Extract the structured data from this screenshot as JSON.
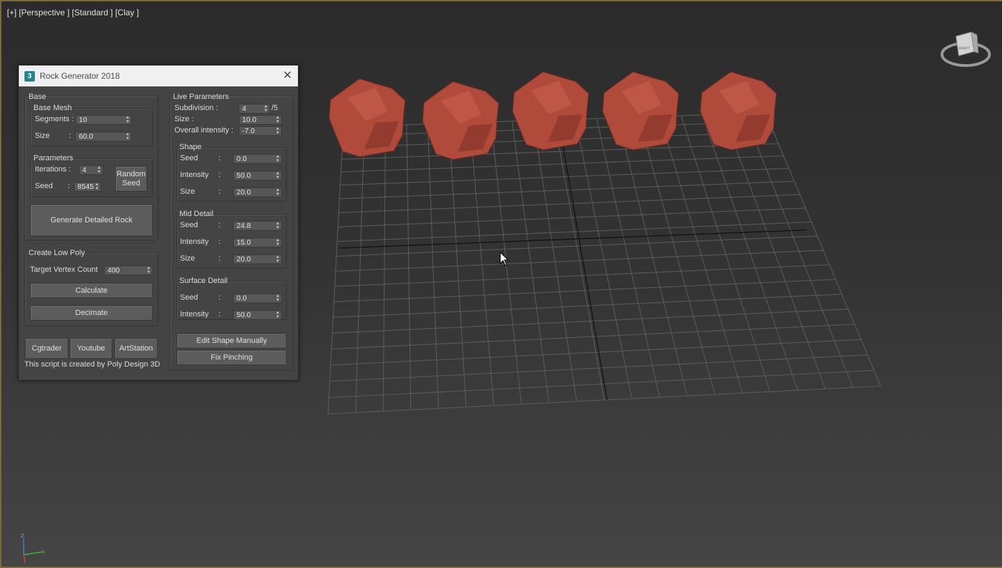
{
  "viewport": {
    "label": "[+] [Perspective ] [Standard ] [Clay ]"
  },
  "viewcube": {
    "face": "RIGHT"
  },
  "axis": {
    "z": "z",
    "x": "x"
  },
  "colors": {
    "rock": "#b04a3a",
    "accent": "#27848f",
    "frame": "#7d6a3c"
  },
  "dialog": {
    "title": "Rock Generator 2018",
    "icon": "3",
    "base": {
      "title": "Base",
      "base_mesh": {
        "title": "Base Mesh",
        "segments_label": "Segments :",
        "segments_value": "10",
        "size_label": "Size",
        "size_colon": ":",
        "size_value": "60.0"
      },
      "parameters": {
        "title": "Parameters",
        "iterations_label": "Iterations :",
        "iterations_value": "4",
        "seed_label": "Seed",
        "seed_colon": ":",
        "seed_value": "8545",
        "random_seed": "Random Seed"
      },
      "generate": "Generate Detailed Rock"
    },
    "low_poly": {
      "title": "Create Low Poly",
      "target_label": "Target Vertex Count",
      "target_value": "400",
      "calculate": "Calculate",
      "decimate": "Decimate"
    },
    "links": {
      "cgtrader": "Cgtrader",
      "youtube": "Youtube",
      "artstation": "ArtStation"
    },
    "credit": "This script is created by Poly Design 3D",
    "live": {
      "title": "Live Parameters",
      "subdivision_label": "Subdivision :",
      "subdivision_value": "4",
      "subdivision_max": "/5",
      "size_label": "Size :",
      "size_value": "10.0",
      "overall_label": "Overall intensity :",
      "overall_value": "-7.0",
      "shape": {
        "title": "Shape",
        "seed_label": "Seed",
        "seed_value": "0.0",
        "intensity_label": "Intensity",
        "intensity_value": "50.0",
        "size_label": "Size",
        "size_value": "20.0"
      },
      "mid": {
        "title": "Mid Detail",
        "seed_label": "Seed",
        "seed_value": "24.8",
        "intensity_label": "Intensity",
        "intensity_value": "15.0",
        "size_label": "Size",
        "size_value": "20.0"
      },
      "surface": {
        "title": "Surface Detail",
        "seed_label": "Seed",
        "seed_value": "0.0",
        "intensity_label": "Intensity",
        "intensity_value": "50.0"
      },
      "colon": ":",
      "edit_shape": "Edit Shape Manually",
      "fix_pinching": "Fix Pinching"
    }
  }
}
